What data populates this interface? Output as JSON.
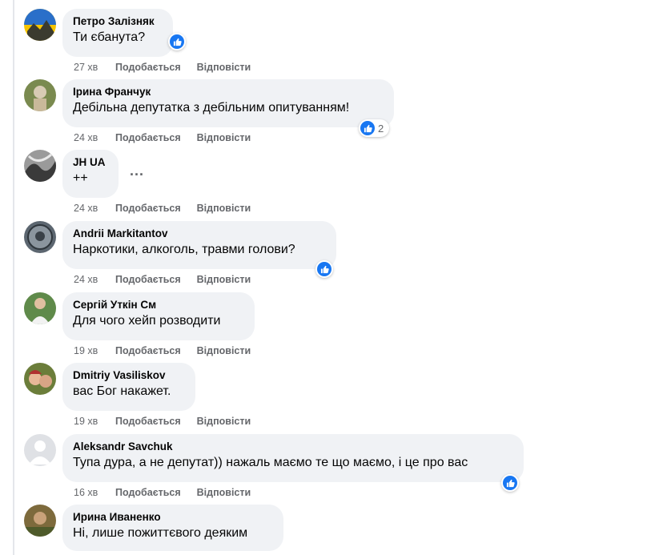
{
  "comments": [
    {
      "author": "Петро Залізняк",
      "text": "Ти єбанута?",
      "time": "27 хв",
      "like_label": "Подобається",
      "reply_label": "Відповісти",
      "reactions": ""
    },
    {
      "author": "Ірина Франчук",
      "text": "Дебільна депутатка з дебільним опитуванням!",
      "time": "24 хв",
      "like_label": "Подобається",
      "reply_label": "Відповісти",
      "reactions": "2"
    },
    {
      "author": "JH UA",
      "text": "++",
      "time": "24 хв",
      "like_label": "Подобається",
      "reply_label": "Відповісти",
      "reactions": ""
    },
    {
      "author": "Andrii Markitantov",
      "text": "Наркотики, алкоголь, травми голови?",
      "time": "24 хв",
      "like_label": "Подобається",
      "reply_label": "Відповісти",
      "reactions": ""
    },
    {
      "author": "Сергій Уткін См",
      "text": "Для чого хейп розводити",
      "time": "19 хв",
      "like_label": "Подобається",
      "reply_label": "Відповісти",
      "reactions": ""
    },
    {
      "author": "Dmitriy Vasiliskov",
      "text": "вас Бог накажет.",
      "time": "19 хв",
      "like_label": "Подобається",
      "reply_label": "Відповісти",
      "reactions": ""
    },
    {
      "author": "Aleksandr Savchuk",
      "text": "Тупа дура, а не депутат)) нажаль маємо те що маємо, і це про вас",
      "time": "16 хв",
      "like_label": "Подобається",
      "reply_label": "Відповісти",
      "reactions": ""
    },
    {
      "author": "Ирина Иваненко",
      "text": "Ні, лише пожиттєвого деяким",
      "time": "",
      "like_label": "",
      "reply_label": "",
      "reactions": ""
    }
  ],
  "more_options": "...",
  "colors": {
    "bubble": "#f0f2f5",
    "meta_text": "#65676b",
    "like_blue": "#1877f2",
    "thread_line": "#e4e6eb"
  },
  "icons": {
    "like": "thumbs-up-icon",
    "more": "more-options-icon"
  }
}
